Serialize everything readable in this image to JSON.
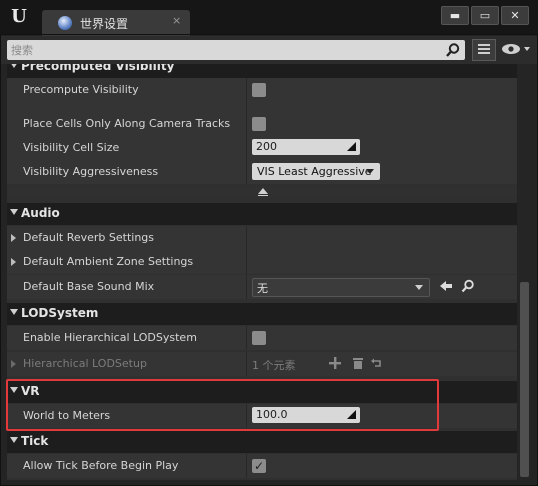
{
  "window": {
    "app_logo": "ue-logo-icon",
    "tab_title": "世界设置",
    "tab_close": "×",
    "controls": {
      "minimize": "▬",
      "maximize": "▭",
      "close": "✕"
    }
  },
  "search": {
    "placeholder": "搜索"
  },
  "sections": {
    "precomputed": {
      "title": "Precomputed Visibility"
    },
    "audio": {
      "title": "Audio"
    },
    "lod": {
      "title": "LODSystem"
    },
    "vr": {
      "title": "VR"
    },
    "tick": {
      "title": "Tick"
    }
  },
  "rows": {
    "precompute_visibility": {
      "label": "Precompute Visibility",
      "checked": false
    },
    "place_cells": {
      "label": "Place Cells Only Along Camera Tracks",
      "checked": false
    },
    "cell_size": {
      "label": "Visibility Cell Size",
      "value": "200"
    },
    "aggressiveness": {
      "label": "Visibility Aggressiveness",
      "value": "VIS Least Aggressive"
    },
    "reverb": {
      "label": "Default Reverb Settings"
    },
    "ambient_zone": {
      "label": "Default Ambient Zone Settings"
    },
    "base_sound_mix": {
      "label": "Default Base Sound Mix",
      "value": "无"
    },
    "enable_hlod": {
      "label": "Enable Hierarchical LODSystem",
      "checked": false
    },
    "hlod_setup": {
      "label": "Hierarchical LODSetup",
      "count": "1 个元素"
    },
    "world_to_meters": {
      "label": "World to Meters",
      "value": "100.0"
    },
    "allow_tick": {
      "label": "Allow Tick Before Begin Play",
      "checked": true,
      "check_mark": "✓"
    }
  },
  "colors": {
    "highlight": "#e23a3a",
    "background": "#242424"
  }
}
